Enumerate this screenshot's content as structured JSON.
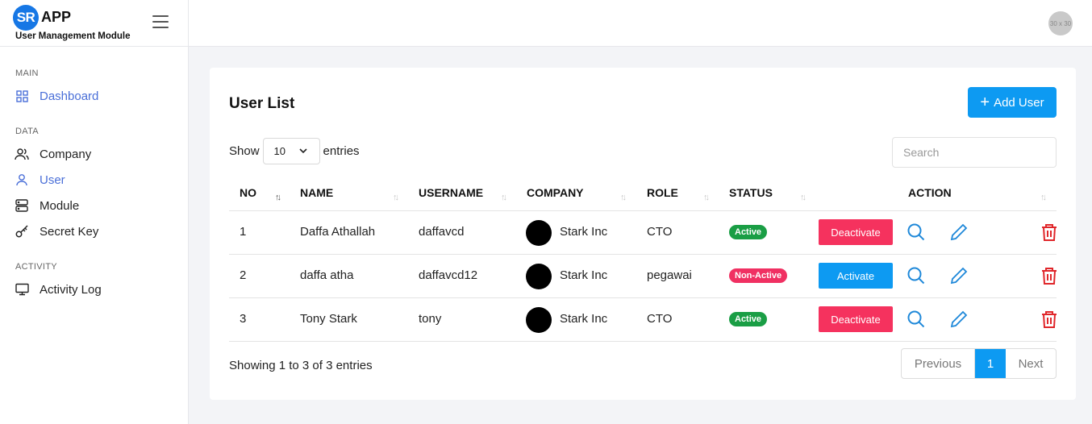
{
  "brand": {
    "logo": "SR",
    "app": "APP",
    "subtitle": "User Management Module"
  },
  "sidebar": {
    "sections": [
      {
        "label": "MAIN"
      },
      {
        "label": "DATA"
      },
      {
        "label": "ACTIVITY"
      }
    ],
    "items": [
      {
        "label": "Dashboard",
        "icon": "grid-icon",
        "active": true
      },
      {
        "label": "Company",
        "icon": "users-icon",
        "active": false
      },
      {
        "label": "User",
        "icon": "user-icon",
        "active": true
      },
      {
        "label": "Module",
        "icon": "server-icon",
        "active": false
      },
      {
        "label": "Secret Key",
        "icon": "key-icon",
        "active": false
      },
      {
        "label": "Activity Log",
        "icon": "monitor-icon",
        "active": false
      }
    ]
  },
  "topbar": {
    "avatar_text": "30 x 30"
  },
  "card": {
    "title": "User List",
    "add_label": "Add User",
    "show_label": "Show",
    "entries_value": "10",
    "entries_label": "entries",
    "search_placeholder": "Search"
  },
  "table": {
    "headers": [
      "NO",
      "NAME",
      "USERNAME",
      "COMPANY",
      "ROLE",
      "STATUS",
      "ACTION"
    ],
    "rows": [
      {
        "no": "1",
        "name": "Daffa Athallah",
        "username": "daffavcd",
        "company": "Stark Inc",
        "role": "CTO",
        "status": "Active",
        "action": "Deactivate"
      },
      {
        "no": "2",
        "name": "daffa atha",
        "username": "daffavcd12",
        "company": "Stark Inc",
        "role": "pegawai",
        "status": "Non-Active",
        "action": "Activate"
      },
      {
        "no": "3",
        "name": "Tony Stark",
        "username": "tony",
        "company": "Stark Inc",
        "role": "CTO",
        "status": "Active",
        "action": "Deactivate"
      }
    ]
  },
  "footer": {
    "info": "Showing 1 to 3 of 3 entries",
    "previous": "Previous",
    "current_page": "1",
    "next": "Next"
  },
  "colors": {
    "primary": "#0d9af2",
    "danger": "#f5325e",
    "success": "#1a9e45",
    "nav_active": "#4a6fd8"
  }
}
